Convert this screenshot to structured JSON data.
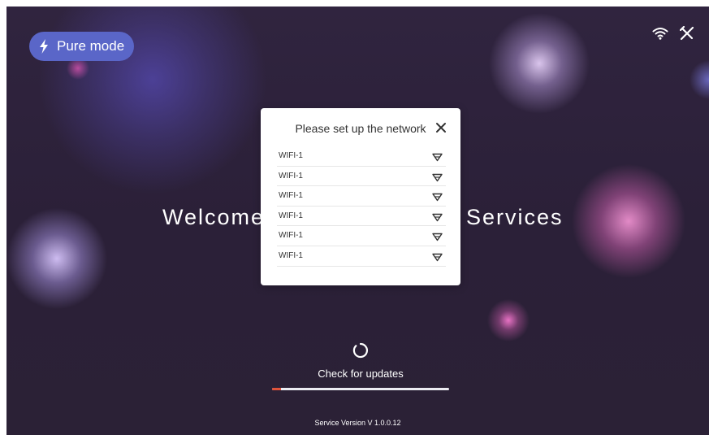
{
  "header": {
    "mode_label": "Pure mode",
    "mode_icon": "lightning-icon",
    "right_icons": [
      "wifi-icon",
      "tools-icon"
    ]
  },
  "welcome": {
    "left_text": "Welcome",
    "right_text": "Services"
  },
  "network_dialog": {
    "title": "Please set up the network",
    "close_icon": "close-icon",
    "networks": [
      {
        "name": "WIFI-1",
        "icon": "wifi-signal-icon"
      },
      {
        "name": "WIFI-1",
        "icon": "wifi-signal-icon"
      },
      {
        "name": "WIFI-1",
        "icon": "wifi-signal-icon"
      },
      {
        "name": "WIFI-1",
        "icon": "wifi-signal-icon"
      },
      {
        "name": "WIFI-1",
        "icon": "wifi-signal-icon"
      },
      {
        "name": "WIFI-1",
        "icon": "wifi-signal-icon"
      }
    ]
  },
  "update": {
    "icon": "refresh-spinner-icon",
    "label": "Check for updates",
    "progress": 0.05
  },
  "footer": {
    "version": "Service Version V 1.0.0.12"
  },
  "colors": {
    "accent_pill": "#5a66c8",
    "progress_fill": "#e0533a",
    "background": "#2b2038"
  }
}
